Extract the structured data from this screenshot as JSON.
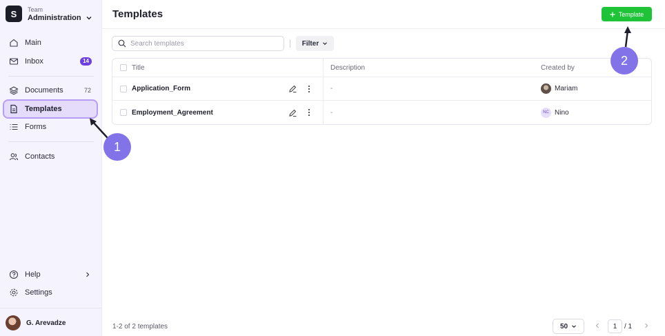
{
  "team": {
    "logo_letter": "S",
    "label": "Team",
    "name": "Administration"
  },
  "sidebar": {
    "items": [
      {
        "label": "Main",
        "icon": "home-icon"
      },
      {
        "label": "Inbox",
        "icon": "mail-icon",
        "badge": "14"
      },
      {
        "label": "Documents",
        "icon": "layers-icon",
        "count": "72"
      },
      {
        "label": "Templates",
        "icon": "file-icon"
      },
      {
        "label": "Forms",
        "icon": "list-icon"
      },
      {
        "label": "Contacts",
        "icon": "users-icon"
      },
      {
        "label": "Help",
        "icon": "help-circle-icon"
      },
      {
        "label": "Settings",
        "icon": "gear-icon"
      }
    ],
    "user": {
      "name": "G. Arevadze"
    }
  },
  "header": {
    "title": "Templates",
    "new_button": "Template"
  },
  "toolbar": {
    "search_placeholder": "Search templates",
    "filter_label": "Filter"
  },
  "table": {
    "columns": [
      "Title",
      "Description",
      "Created by"
    ],
    "rows": [
      {
        "title": "Application_Form",
        "description": "-",
        "creator": "Mariam",
        "avatar_type": "photo"
      },
      {
        "title": "Employment_Agreement",
        "description": "-",
        "creator": "Nino",
        "avatar_type": "initials",
        "initials": "NC"
      }
    ]
  },
  "footer": {
    "count_text": "1-2 of 2 templates",
    "per_page": "50",
    "page": "1",
    "page_total": "/ 1"
  },
  "callouts": [
    "1",
    "2"
  ],
  "colors": {
    "accent": "#6d3fe0",
    "primary_button": "#1ec338",
    "callout": "#8273e9",
    "sidebar_bg": "#f5f3fd"
  }
}
